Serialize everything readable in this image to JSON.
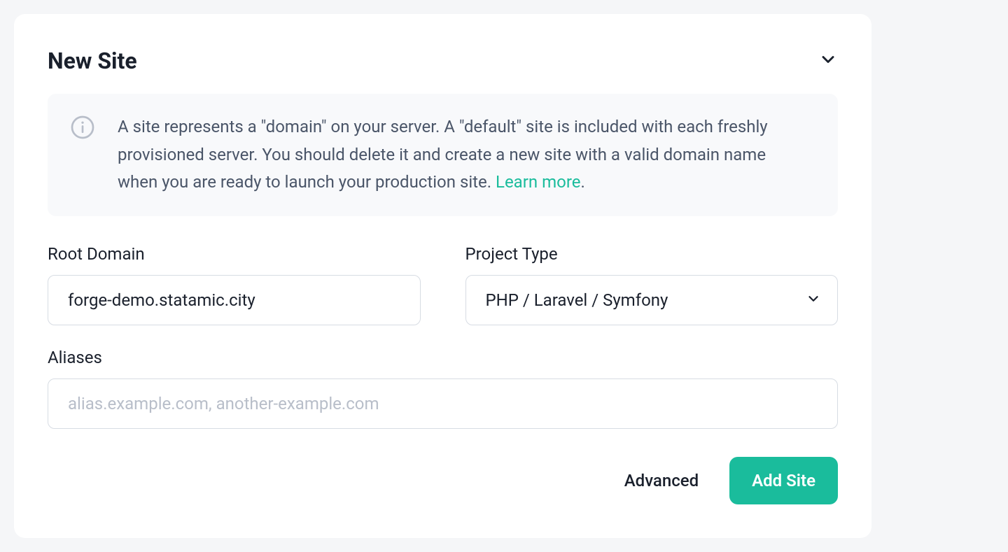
{
  "header": {
    "title": "New Site"
  },
  "info": {
    "text": "A site represents a \"domain\" on your server. A \"default\" site is included with each freshly provisioned server. You should delete it and create a new site with a valid domain name when you are ready to launch your production site. ",
    "link_text": "Learn more",
    "suffix": "."
  },
  "form": {
    "root_domain": {
      "label": "Root Domain",
      "value": "forge-demo.statamic.city"
    },
    "project_type": {
      "label": "Project Type",
      "value": "PHP / Laravel / Symfony"
    },
    "aliases": {
      "label": "Aliases",
      "value": "",
      "placeholder": "alias.example.com, another-example.com"
    }
  },
  "actions": {
    "advanced": "Advanced",
    "submit": "Add Site"
  }
}
